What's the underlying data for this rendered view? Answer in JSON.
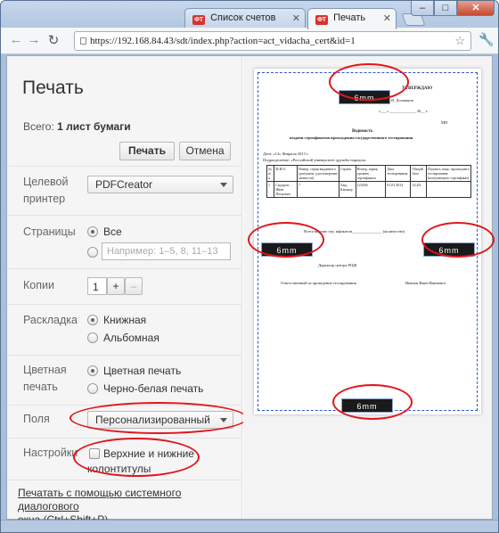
{
  "browser": {
    "tabs": [
      {
        "favicon": "ФТ",
        "label": "Список счетов"
      },
      {
        "favicon": "ФТ",
        "label": "Печать"
      }
    ],
    "url": "https://192.168.84.43/sdt/index.php?action=act_vidacha_cert&id=1",
    "window_buttons": {
      "minimize": "–",
      "maximize": "□",
      "close": "✕"
    }
  },
  "sidebar": {
    "title": "Печать",
    "total_label": "Всего:",
    "total_value": "1 лист бумаги",
    "print_button": "Печать",
    "cancel_button": "Отмена",
    "printer_label_1": "Целевой",
    "printer_label_2": "принтер",
    "printer_value": "PDFCreator",
    "pages_label": "Страницы",
    "pages_all": "Все",
    "pages_placeholder": "Например: 1–5, 8, 11–13",
    "copies_label": "Копии",
    "copies_value": "1",
    "copies_plus": "+",
    "copies_minus": "–",
    "layout_label": "Раскладка",
    "layout_portrait": "Книжная",
    "layout_landscape": "Альбомная",
    "color_label_1": "Цветная",
    "color_label_2": "печать",
    "color_color": "Цветная печать",
    "color_bw": "Черно-белая печать",
    "margins_label": "Поля",
    "margins_value": "Персонализированный",
    "settings_label": "Настройки",
    "headers_footers_1": "Верхние и нижние",
    "headers_footers_2": "колонтитулы",
    "system_dialog_1": "Печатать с помощью системного диалогового",
    "system_dialog_2": "окна (Ctrl+Shift+P)"
  },
  "preview": {
    "margin_top": "6mm",
    "margin_left": "6mm",
    "margin_right": "6mm",
    "margin_bottom": "6mm",
    "doc": {
      "approve": "УТВЕРЖДАЮ",
      "approver_line": "Проректор ____________ А.В. Должиков",
      "date_line": "«___» _____________ 20__ г.",
      "mp": "МП",
      "title": "Ведомость",
      "subtitle": "выдачи сертификатов прохождения государственного тестирования",
      "date": "Дата: «14» Февраля 2013 г.",
      "division": "Подразделение: «Российский университет дружбы народов»",
      "table_headers": [
        "№ п/п",
        "Ф.И.О.",
        "Номер, серия выданного (документ, удостоверение личности)",
        "Страна",
        "Номер, серия, уровень сертификата",
        "Дата тестирования",
        "Общий балл",
        "Подпись лица, прошедшего тестирование (получающего сертификат)"
      ],
      "table_row": [
        "1",
        "Сидоров Иван Петрович",
        "7",
        "Амд Кашкир",
        "123456",
        "01.01.2013",
        "14,4%",
        ""
      ],
      "total_line": "Всего выдано сер. ификатов_______________ (количество)",
      "director": "Директор центра РЦЖ",
      "responsible": "Ответственный за проведение тестирования",
      "responsible_name": "Иванов Иван Иванович"
    }
  }
}
